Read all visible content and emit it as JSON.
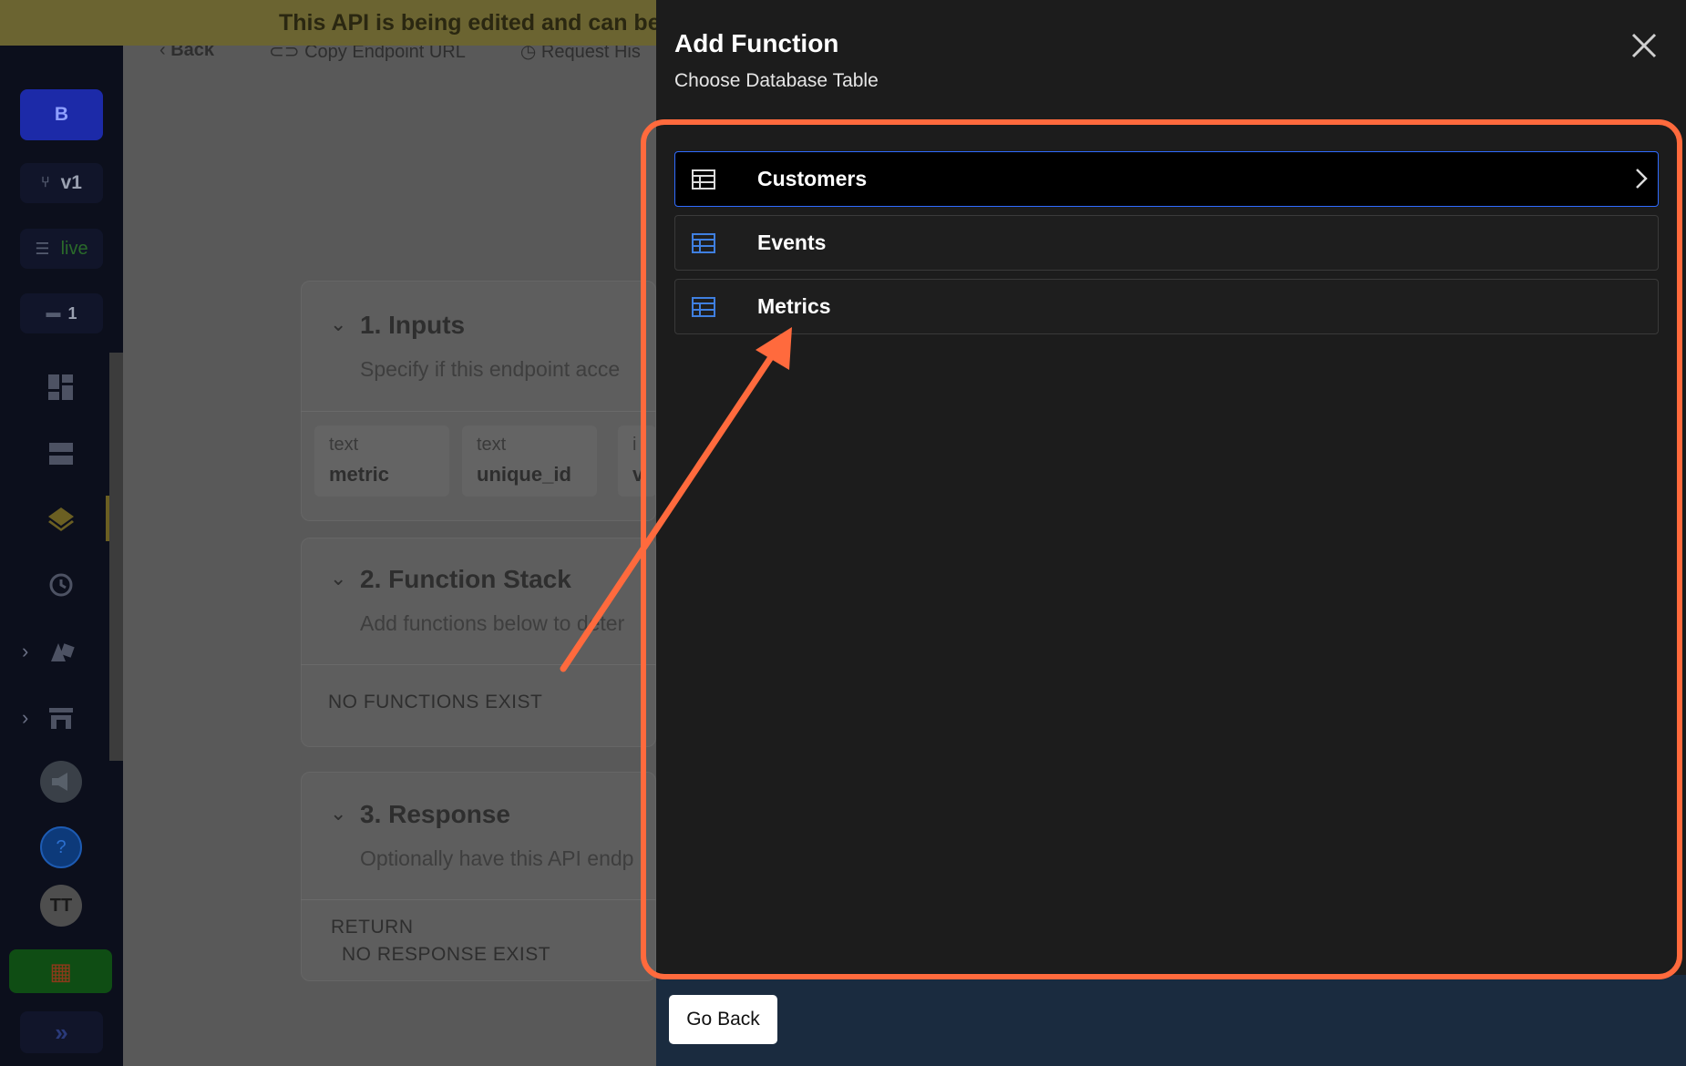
{
  "banner": {
    "text": "This API is being edited and can be"
  },
  "toolbar": {
    "back": "Back",
    "copy_endpoint": "Copy Endpoint URL",
    "request_history": "Request His"
  },
  "sidebar": {
    "workspace_initial": "B",
    "branch": "v1",
    "datasource": "live",
    "comments_count": "1",
    "avatar_initials": "TT"
  },
  "main": {
    "inputs": {
      "title": "1. Inputs",
      "description": "Specify if this endpoint acce",
      "fields": [
        {
          "type": "text",
          "name": "metric"
        },
        {
          "type": "text",
          "name": "unique_id"
        },
        {
          "type": "i",
          "name": "v"
        }
      ]
    },
    "function_stack": {
      "title": "2. Function Stack",
      "description": "Add functions below to deter",
      "empty": "NO FUNCTIONS EXIST"
    },
    "response": {
      "title": "3. Response",
      "description": "Optionally have this API endp",
      "return_label": "RETURN",
      "empty": "NO RESPONSE EXIST"
    }
  },
  "modal": {
    "title": "Add Function",
    "subtitle": "Choose Database Table",
    "tables": [
      {
        "label": "Customers",
        "selected": true
      },
      {
        "label": "Events",
        "selected": false
      },
      {
        "label": "Metrics",
        "selected": false
      }
    ],
    "go_back": "Go Back"
  },
  "colors": {
    "accent_highlight": "#ff6a3d",
    "selected_border": "#2f6bff",
    "table_icon": "#3f7fe0"
  }
}
